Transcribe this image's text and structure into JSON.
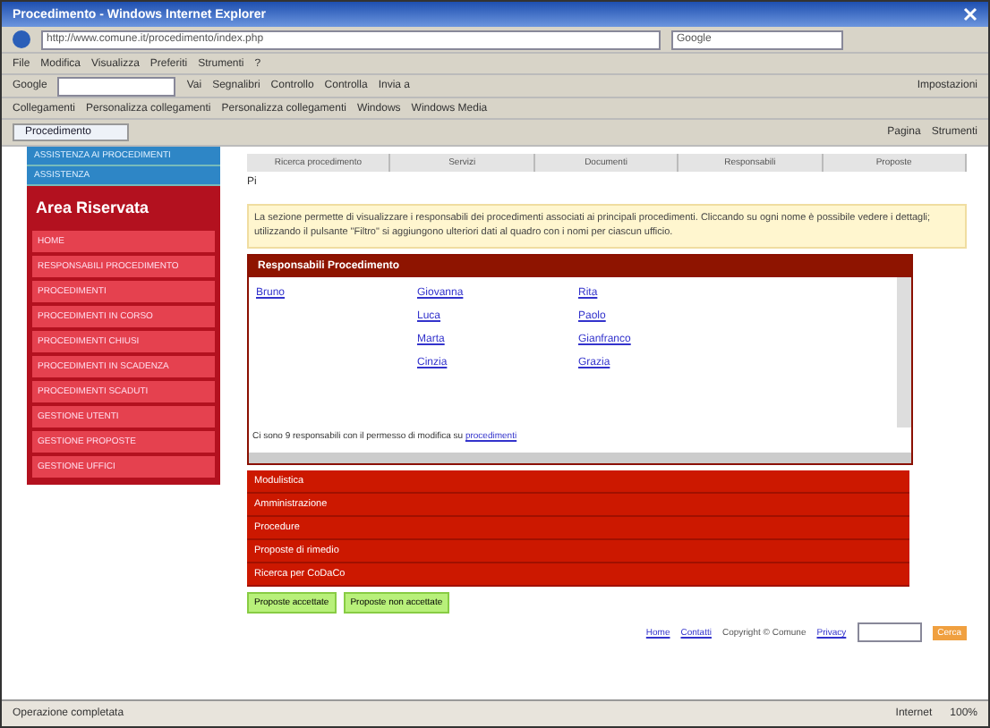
{
  "window": {
    "title": "Procedimento - Windows Internet Explorer"
  },
  "address_bar": {
    "url": "http://www.comune.it/procedimento/index.php",
    "search_placeholder": "Google"
  },
  "menu": [
    "File",
    "Modifica",
    "Visualizza",
    "Preferiti",
    "Strumenti",
    "?"
  ],
  "google_toolbar": {
    "label": "Google",
    "go": "Vai",
    "items": [
      "Segnalibri",
      "Controllo",
      "Controlla",
      "Invia a"
    ],
    "settings": "Impostazioni"
  },
  "links_bar": [
    "Collegamenti",
    "Personalizza collegamenti",
    "Personalizza collegamenti",
    "Windows",
    "Windows Media"
  ],
  "tab": {
    "label": "Procedimento"
  },
  "command_bar": [
    "Pagina",
    "Strumenti"
  ],
  "sidebar": {
    "top_items": [
      "ASSISTENZA AI PROCEDIMENTI",
      "ASSISTENZA"
    ],
    "title": "Area Riservata",
    "items": [
      "HOME",
      "RESPONSABILI PROCEDIMENTO",
      "PROCEDIMENTI",
      "PROCEDIMENTI IN CORSO",
      "PROCEDIMENTI CHIUSI",
      "PROCEDIMENTI IN SCADENZA",
      "PROCEDIMENTI SCADUTI",
      "GESTIONE UTENTI",
      "GESTIONE PROPOSTE",
      "GESTIONE UFFICI"
    ]
  },
  "nav_tabs": [
    "Ricerca procedimento",
    "Servizi",
    "Documenti",
    "Responsabili",
    "Proposte"
  ],
  "path": "Pi",
  "notice": "La sezione permette di visualizzare i responsabili dei procedimenti associati ai principali procedimenti. Cliccando su ogni nome è possibile vedere i dettagli; utilizzando il pulsante \"Filtro\" si aggiungono ulteriori dati al quadro con i nomi per ciascun ufficio.",
  "responsabili": {
    "title": "Responsabili Procedimento",
    "columns": [
      [
        "Bruno"
      ],
      [
        "Giovanna",
        "Luca",
        "Marta",
        "Cinzia"
      ],
      [
        "Rita",
        "Paolo",
        "Gianfranco",
        "Grazia"
      ]
    ],
    "footer": "Ci sono 9 responsabili con il permesso di modifica su",
    "footer_link": "procedimenti"
  },
  "sections": [
    "Modulistica",
    "Amministrazione",
    "Procedure",
    "Proposte di rimedio",
    "Ricerca per CoDaCo"
  ],
  "buttons": [
    "Proposte accettate",
    "Proposte non accettate"
  ],
  "footer": {
    "links": [
      "Home",
      "Contatti"
    ],
    "copyright": "Copyright © Comune",
    "privacy": "Privacy",
    "search_button": "Cerca"
  },
  "status_bar": {
    "text": "Operazione completata",
    "zone": "Internet",
    "zoom": "100%"
  }
}
